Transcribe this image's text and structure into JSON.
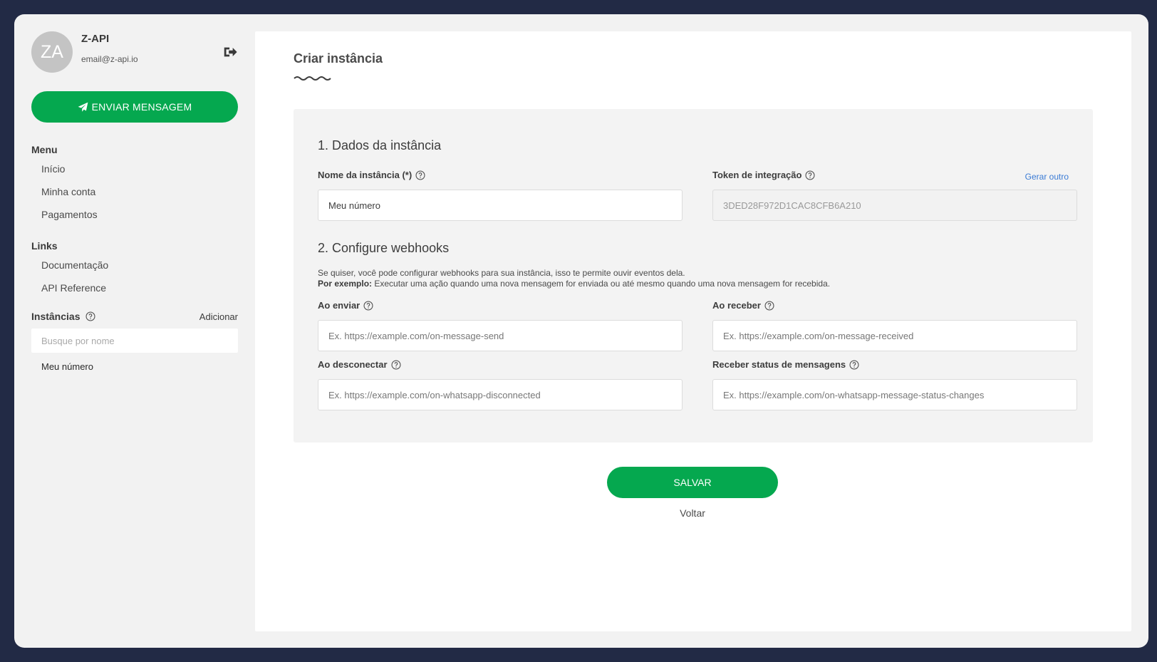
{
  "user": {
    "initials": "ZA",
    "name": "Z-API",
    "email": "email@z-api.io"
  },
  "sidebar": {
    "send_button": "ENVIAR MENSAGEM",
    "menu_title": "Menu",
    "menu_items": [
      {
        "label": "Início"
      },
      {
        "label": "Minha conta"
      },
      {
        "label": "Pagamentos"
      }
    ],
    "links_title": "Links",
    "links_items": [
      {
        "label": "Documentação"
      },
      {
        "label": "API Reference"
      }
    ],
    "instances_title": "Instâncias",
    "add_label": "Adicionar",
    "search_placeholder": "Busque por nome",
    "instances": [
      {
        "label": "Meu número"
      }
    ]
  },
  "main": {
    "title": "Criar instância",
    "section1_title": "1. Dados da instância",
    "name_label": "Nome da instância (*)",
    "name_value": "Meu número",
    "token_label": "Token de integração",
    "token_value": "3DED28F972D1CAC8CFB6A210",
    "generate_label": "Gerar outro",
    "section2_title": "2. Configure webhooks",
    "description_line1": "Se quiser, você pode configurar webhooks para sua instância, isso te permite ouvir eventos dela.",
    "description_bold": "Por exemplo:",
    "description_line2": " Executar uma ação quando uma nova mensagem for enviada ou até mesmo quando uma nova mensagem for recebida.",
    "send_label": "Ao enviar",
    "send_placeholder": "Ex. https://example.com/on-message-send",
    "receive_label": "Ao receber",
    "receive_placeholder": "Ex. https://example.com/on-message-received",
    "disconnect_label": "Ao desconectar",
    "disconnect_placeholder": "Ex. https://example.com/on-whatsapp-disconnected",
    "status_label": "Receber status de mensagens",
    "status_placeholder": "Ex. https://example.com/on-whatsapp-message-status-changes",
    "save_button": "SALVAR",
    "back_link": "Voltar"
  },
  "colors": {
    "background": "#222a45",
    "primary": "#05a84f",
    "link": "#3a7bd5"
  }
}
